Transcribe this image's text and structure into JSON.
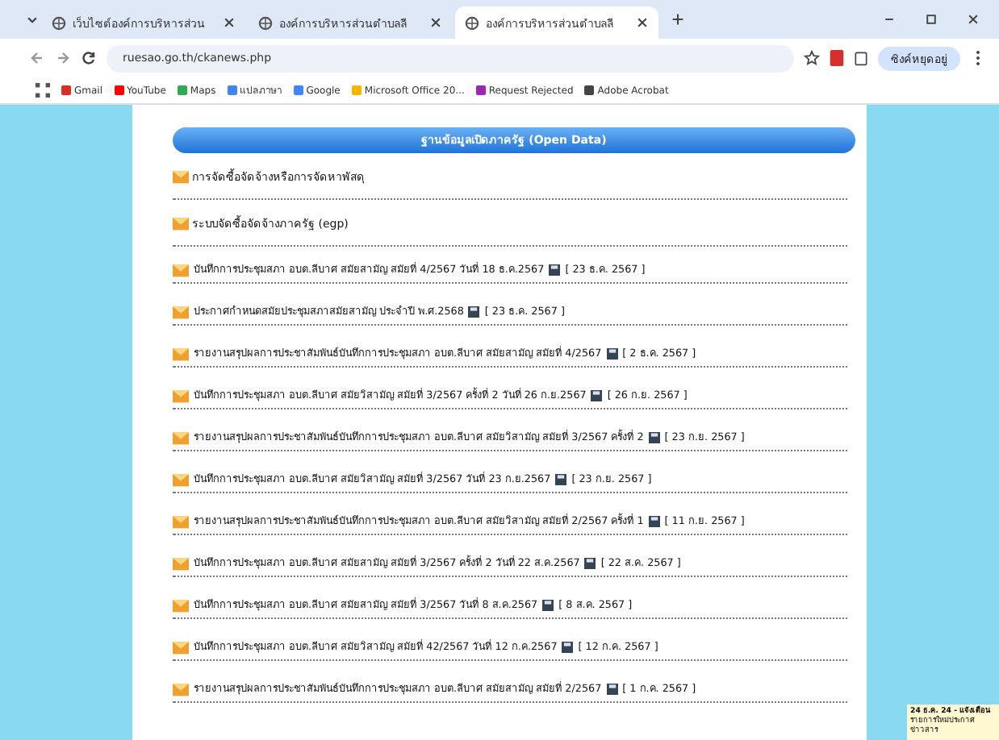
{
  "browser": {
    "tabs": [
      {
        "title": "เว็บไซต์องค์การบริหารส่วน",
        "selected": false
      },
      {
        "title": "องค์การบริหารส่วนตำบลลี",
        "selected": false
      },
      {
        "title": "องค์การบริหารส่วนตำบลลี",
        "selected": true
      }
    ],
    "url": "ruesao.go.th/ckanews.php",
    "profile": "ซิงค์หยุดอยู่",
    "bookmarks": [
      {
        "label": "Gmail",
        "color": "#d93025"
      },
      {
        "label": "YouTube",
        "color": "#ff0000"
      },
      {
        "label": "Maps",
        "color": "#34a853"
      },
      {
        "label": "แปลภาษา",
        "color": "#4285f4"
      },
      {
        "label": "Google",
        "color": "#4285f4"
      },
      {
        "label": "Microsoft Office 20...",
        "color": "#f4b400"
      },
      {
        "label": "Request Rejected",
        "color": "#9c27b0"
      },
      {
        "label": "Adobe Acrobat",
        "color": "#444444"
      }
    ]
  },
  "page": {
    "header": "ฐานข้อมูลเปิดภาครัฐ (Open Data)",
    "links": [
      "การจัดซื้อจัดจ้างหรือการจัดหาพัสดุ",
      "ระบบจัดซื้อจัดจ้างภาครัฐ (egp)"
    ],
    "items": [
      {
        "title": "บันทึกการประชุมสภา อบต.ลีบาศ สมัยสามัญ สมัยที่ 4/2567 วันที่ 18 ธ.ค.2567",
        "date": "[ 23 ธ.ค. 2567 ]"
      },
      {
        "title": "ประกาศกำหนดสมัยประชุมสภาสมัยสามัญ ประจำปี พ.ศ.2568",
        "date": "[ 23 ธ.ค. 2567 ]"
      },
      {
        "title": "รายงานสรุปผลการประชาสัมพันธ์บันทึกการประชุมสภา อบต.ลีบาศ สมัยสามัญ สมัยที่ 4/2567",
        "date": "[ 2 ธ.ค. 2567 ]"
      },
      {
        "title": "บันทึกการประชุมสภา อบต.ลีบาศ สมัยวิสามัญ สมัยที่ 3/2567 ครั้งที่ 2 วันที่ 26 ก.ย.2567",
        "date": "[ 26 ก.ย. 2567 ]"
      },
      {
        "title": "รายงานสรุปผลการประชาสัมพันธ์บันทึกการประชุมสภา อบต.ลีบาศ สมัยวิสามัญ สมัยที่ 3/2567 ครั้งที่ 2",
        "date": "[ 23 ก.ย. 2567 ]"
      },
      {
        "title": "บันทึกการประชุมสภา อบต.ลีบาศ สมัยวิสามัญ สมัยที่ 3/2567 วันที่ 23 ก.ย.2567",
        "date": "[ 23 ก.ย. 2567 ]"
      },
      {
        "title": "รายงานสรุปผลการประชาสัมพันธ์บันทึกการประชุมสภา อบต.ลีบาศ สมัยวิสามัญ สมัยที่ 2/2567 ครั้งที่ 1",
        "date": "[ 11 ก.ย. 2567 ]"
      },
      {
        "title": "บันทึกการประชุมสภา อบต.ลีบาศ สมัยสามัญ สมัยที่ 3/2567 ครั้งที่ 2 วันที่ 22 ส.ค.2567",
        "date": "[ 22 ส.ค. 2567 ]"
      },
      {
        "title": "บันทึกการประชุมสภา อบต.ลีบาศ สมัยสามัญ สมัยที่ 3/2567 วันที่ 8 ส.ค.2567",
        "date": "[ 8 ส.ค. 2567 ]"
      },
      {
        "title": "บันทึกการประชุมสภา อบต.ลีบาศ สมัยวิสามัญ สมัยที่ 42/2567 วันที่ 12 ก.ค.2567",
        "date": "[ 12 ก.ค. 2567 ]"
      },
      {
        "title": "รายงานสรุปผลการประชาสัมพันธ์บันทึกการประชุมสภา อบต.ลีบาศ สมัยสามัญ สมัยที่ 2/2567",
        "date": "[ 1 ก.ค. 2567 ]"
      }
    ]
  },
  "notice": {
    "title": "24 ธ.ค. 24 - แจ้งเตือน",
    "body": "รายการใหม่ประกาศ ข่าวสาร"
  }
}
